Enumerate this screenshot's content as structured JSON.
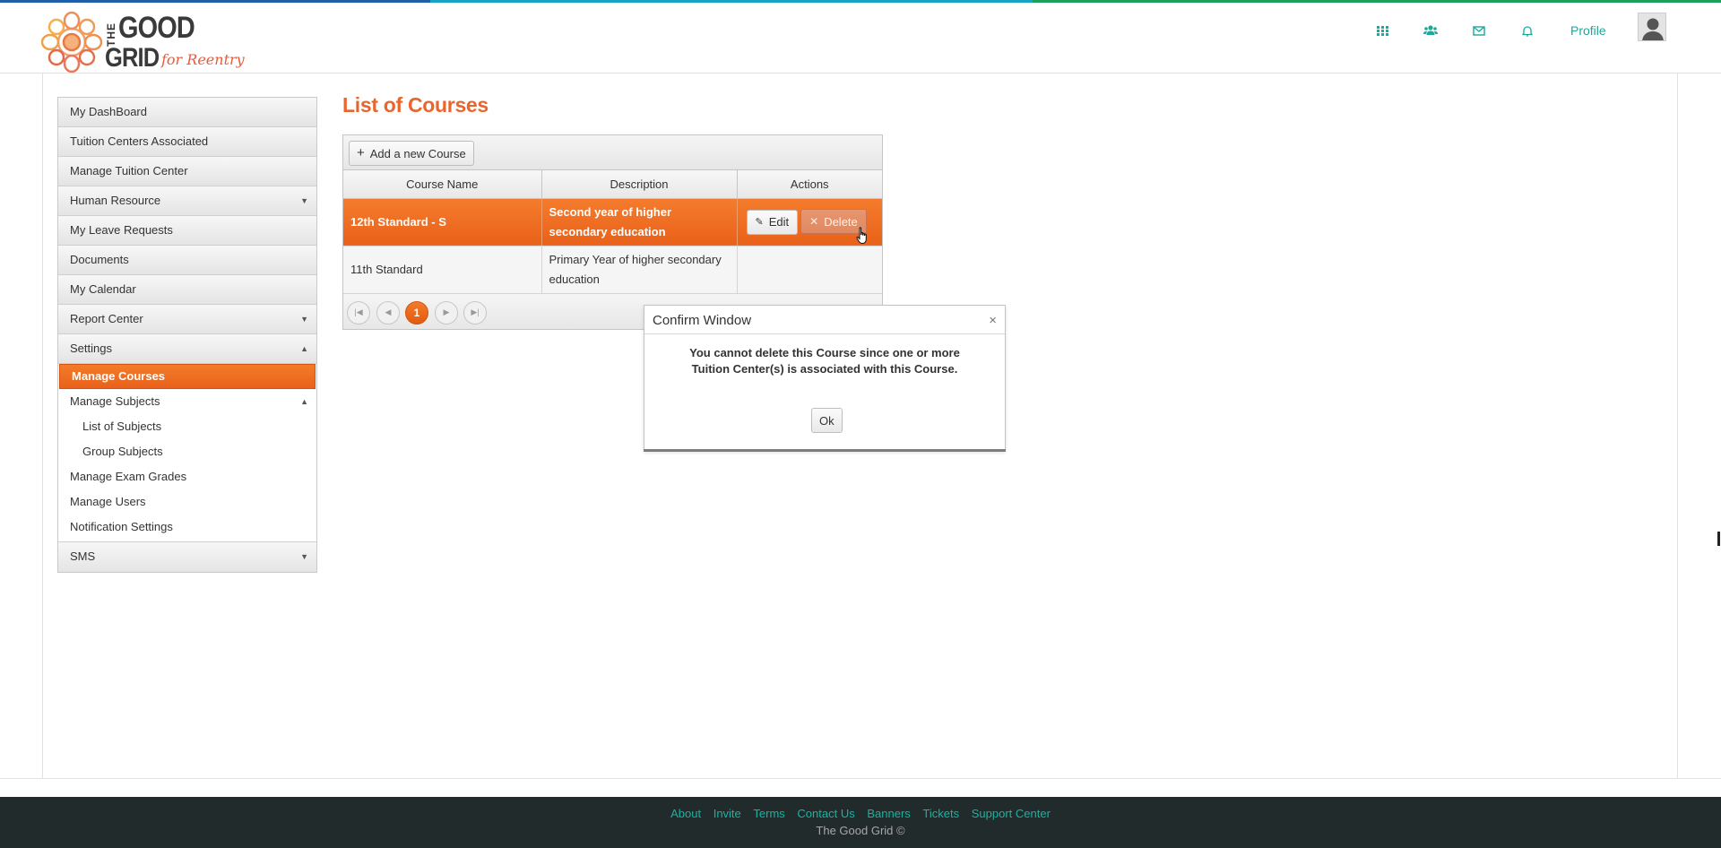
{
  "header": {
    "logo": {
      "the": "THE",
      "good": "GOOD",
      "grid": "GRID",
      "tagline": "for Reentry"
    },
    "icons": [
      "apps-grid-icon",
      "people-icon",
      "mail-icon",
      "bell-icon"
    ],
    "profile_label": "Profile",
    "accent_color": "#1aa99a"
  },
  "sidebar": {
    "items": [
      {
        "label": "My DashBoard"
      },
      {
        "label": "Tuition Centers Associated"
      },
      {
        "label": "Manage Tuition Center"
      },
      {
        "label": "Human Resource",
        "arrow": "▼"
      },
      {
        "label": "My Leave Requests"
      },
      {
        "label": "Documents"
      },
      {
        "label": "My Calendar"
      },
      {
        "label": "Report Center",
        "arrow": "▼"
      },
      {
        "label": "Settings",
        "arrow": "▲"
      }
    ],
    "settings_sub": [
      {
        "label": "Manage Courses",
        "active": true
      },
      {
        "label": "Manage Subjects",
        "arrow": "▲"
      },
      {
        "label": "List of Subjects"
      },
      {
        "label": "Group Subjects"
      },
      {
        "label": "Manage Exam Grades"
      },
      {
        "label": "Manage Users"
      },
      {
        "label": "Notification Settings"
      }
    ],
    "last": {
      "label": "SMS",
      "arrow": "▼"
    },
    "active_color": "#ef6c1f"
  },
  "main": {
    "title": "List of Courses",
    "add_button": "Add a new Course",
    "columns": [
      "Course Name",
      "Description",
      "Actions"
    ],
    "rows": [
      {
        "name": "12th Standard - S",
        "description": "Second year of higher secondary education",
        "selected": true
      },
      {
        "name": "11th Standard",
        "description": "Primary Year of higher secondary education",
        "selected": false
      }
    ],
    "actions": {
      "edit": "Edit",
      "delete": "Delete"
    },
    "pager": {
      "current_page": "1"
    },
    "title_color": "#e8662e"
  },
  "modal": {
    "title": "Confirm Window",
    "message_line1": "You cannot delete this Course since one or more",
    "message_line2": "Tuition Center(s) is associated with this Course.",
    "ok_label": "Ok",
    "close_glyph": "×"
  },
  "footer": {
    "links": [
      "About",
      "Invite",
      "Terms",
      "Contact Us",
      "Banners",
      "Tickets",
      "Support Center"
    ],
    "copyright": "The Good Grid ©",
    "link_color": "#1ab2a2"
  }
}
